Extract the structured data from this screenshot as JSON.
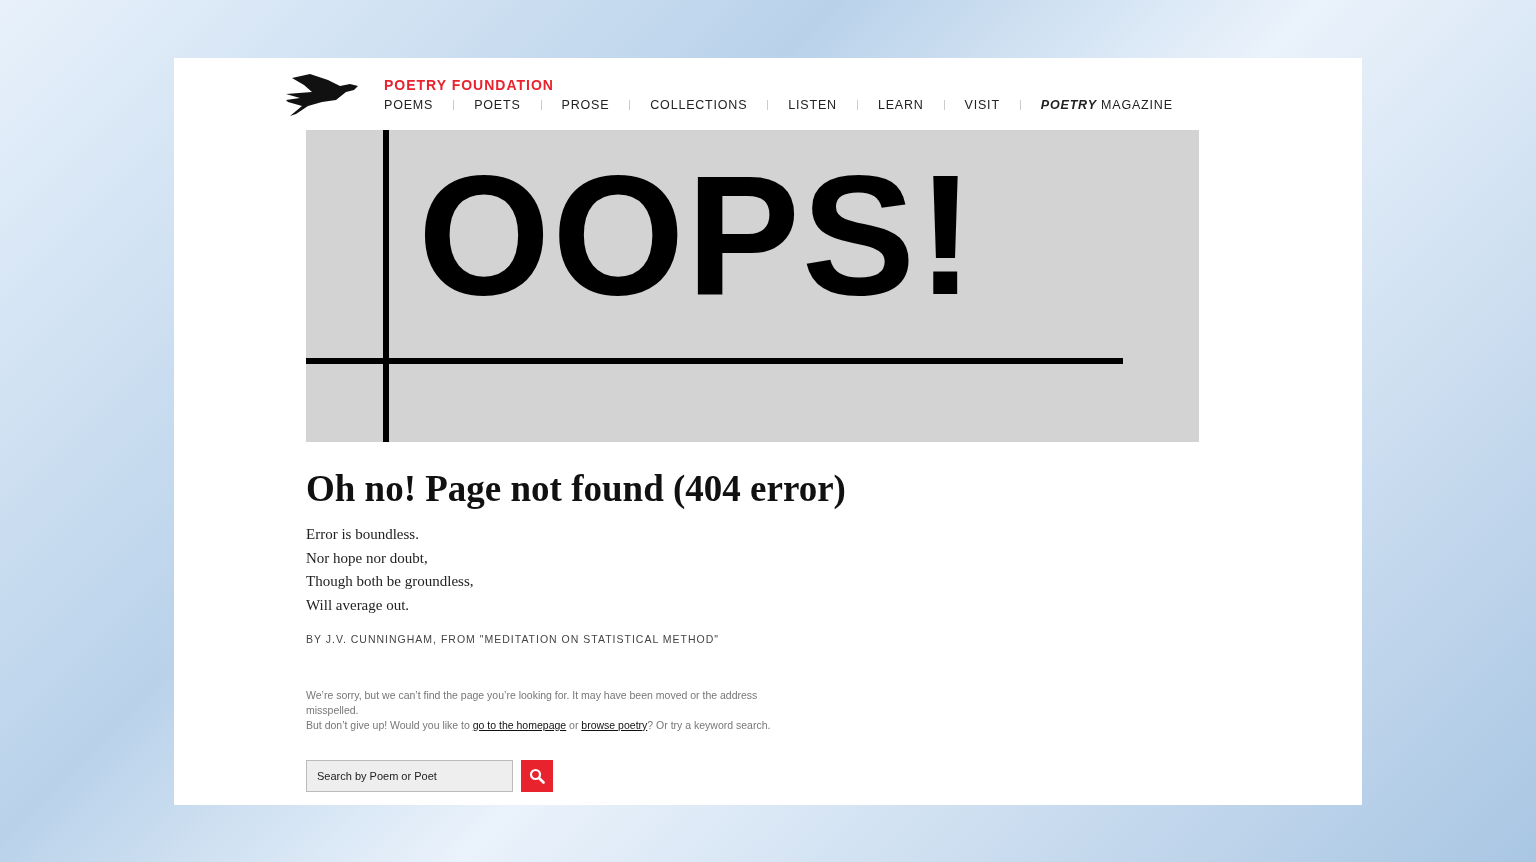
{
  "site": {
    "name": "POETRY FOUNDATION"
  },
  "nav": [
    {
      "label": "POEMS"
    },
    {
      "label": "POETS"
    },
    {
      "label": "PROSE"
    },
    {
      "label": "COLLECTIONS"
    },
    {
      "label": "LISTEN"
    },
    {
      "label": "LEARN"
    },
    {
      "label": "VISIT"
    },
    {
      "label": "**POETRY** MAGAZINE"
    }
  ],
  "banner": {
    "text": "OOPS!"
  },
  "heading": "Oh no! Page not found (404 error)",
  "poem": [
    "Error is boundless.",
    "Nor hope nor doubt,",
    "Though both be groundless,",
    "Will average out."
  ],
  "byline": "BY J.V. CUNNINGHAM, FROM \"MEDITATION ON STATISTICAL METHOD\"",
  "help": [
    {
      "kind": "text",
      "text": "We’re sorry, but we can’t find the page you’re looking for. It may have been moved or the address misspelled."
    },
    {
      "kind": "break"
    },
    {
      "kind": "text",
      "text": "But don’t give up! Would you like to "
    },
    {
      "kind": "link",
      "text": "go to the homepage"
    },
    {
      "kind": "text",
      "text": " or "
    },
    {
      "kind": "link",
      "text": "browse poetry"
    },
    {
      "kind": "text",
      "text": "? Or try a keyword search."
    }
  ],
  "search": {
    "placeholder": "Search by Poem or Poet"
  }
}
